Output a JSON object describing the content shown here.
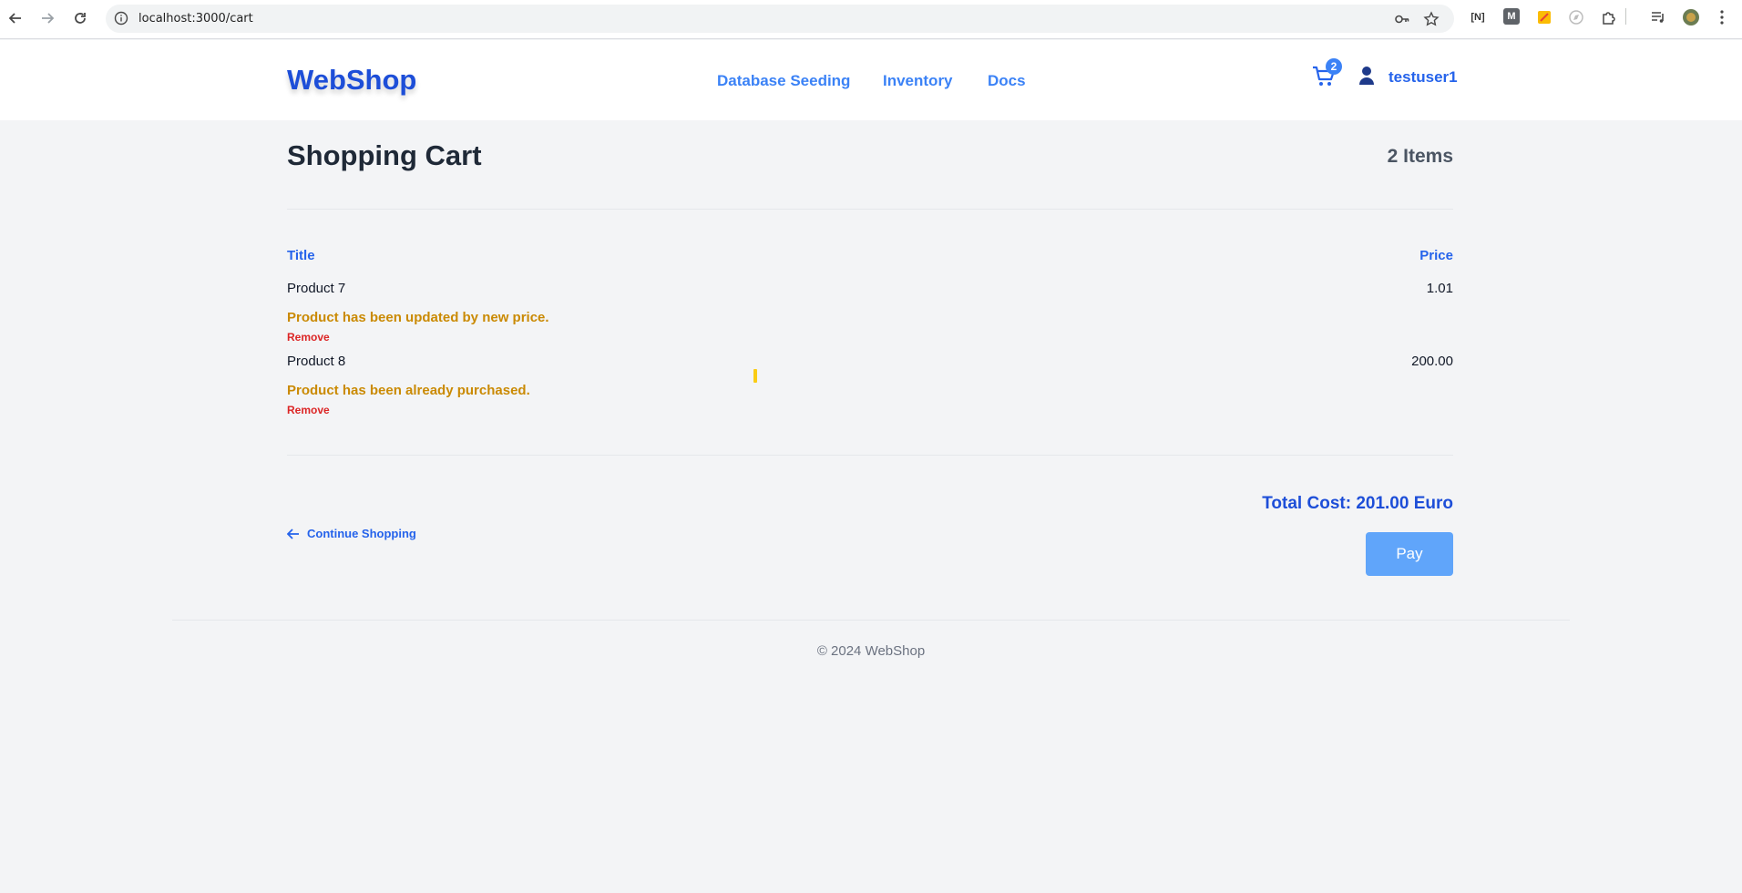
{
  "browser": {
    "url": "localhost:3000/cart"
  },
  "header": {
    "logo": "WebShop",
    "nav": [
      "Database Seeding",
      "Inventory",
      "Docs"
    ],
    "cart_count": "2",
    "username": "testuser1"
  },
  "cart": {
    "title": "Shopping Cart",
    "items_count": "2 Items",
    "columns": {
      "title": "Title",
      "price": "Price"
    },
    "items": [
      {
        "title": "Product 7",
        "price": "1.01",
        "message": "Product has been updated by new price.",
        "remove": "Remove"
      },
      {
        "title": "Product 8",
        "price": "200.00",
        "message": "Product has been already purchased.",
        "remove": "Remove"
      }
    ],
    "total": "Total Cost: 201.00 Euro",
    "continue": "Continue Shopping",
    "pay": "Pay"
  },
  "footer": {
    "text": "© 2024 WebShop"
  },
  "colors": {
    "brand": "#1d4ed8",
    "link": "#3b82f6",
    "warning": "#ca8a04",
    "danger": "#dc2626",
    "pay_button": "#60a5fa"
  }
}
